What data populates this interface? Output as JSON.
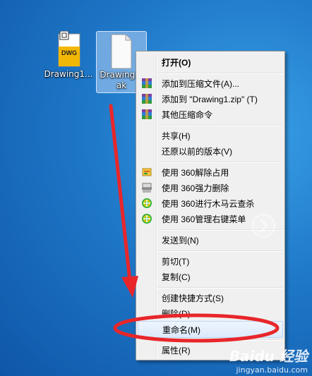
{
  "desktop": {
    "icons": [
      {
        "label": "Drawing1...",
        "badge": "DWG"
      },
      {
        "label": "Drawing1.\nak"
      }
    ]
  },
  "context_menu": {
    "items": [
      {
        "label": "打开(O)"
      },
      {
        "label": "添加到压缩文件(A)...",
        "icon": "winrar-icon"
      },
      {
        "label": "添加到 \"Drawing1.zip\" (T)",
        "icon": "winrar-icon"
      },
      {
        "label": "其他压缩命令",
        "icon": "winrar-icon"
      },
      {
        "label": "共享(H)"
      },
      {
        "label": "还原以前的版本(V)"
      },
      {
        "label": "使用 360解除占用",
        "icon": "unlock-icon"
      },
      {
        "label": "使用 360强力删除",
        "icon": "shredder-icon"
      },
      {
        "label": "使用 360进行木马云查杀",
        "icon": "360-icon"
      },
      {
        "label": "使用 360管理右键菜单",
        "icon": "360-icon"
      },
      {
        "label": "发送到(N)"
      },
      {
        "label": "剪切(T)"
      },
      {
        "label": "复制(C)"
      },
      {
        "label": "创建快捷方式(S)"
      },
      {
        "label": "删除(D)"
      },
      {
        "label": "重命名(M)"
      },
      {
        "label": "属性(R)"
      }
    ]
  },
  "annotation": {
    "color": "#e8262a"
  },
  "watermark": {
    "brand": "Baidu 经验",
    "url": "jingyan.baidu.com"
  }
}
